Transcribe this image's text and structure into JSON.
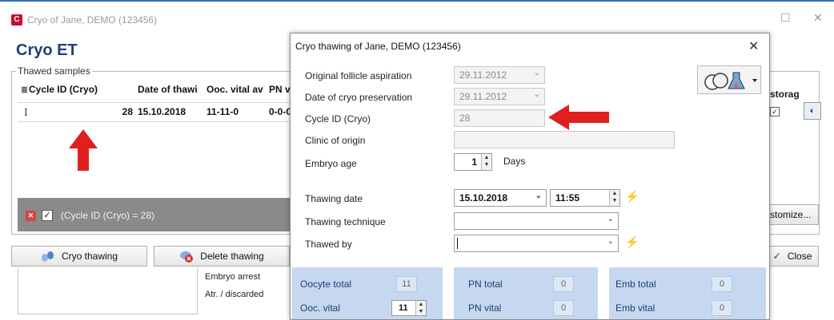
{
  "window": {
    "title": "Cryo of Jane, DEMO (123456)",
    "heading": "Cryo ET",
    "minimize_label": "—",
    "maximize_label": "☐",
    "close_label": "✕"
  },
  "thawed_samples": {
    "group_label": "Thawed samples",
    "columns": [
      "Cycle ID (Cryo)",
      "Date of thawi",
      "Ooc. vital av",
      "PN v"
    ],
    "row": {
      "cycle_id": "28",
      "date": "15.10.2018",
      "ooc_vital": "11-11-0",
      "pn": "0-0-0"
    },
    "filter_text": "(Cycle ID (Cryo) = 28)",
    "storage_header": "storag",
    "customize_label": "stomize...",
    "close_label": "Close"
  },
  "buttons": {
    "cryo_thawing": "Cryo thawing",
    "delete_thawing": "Delete thawing"
  },
  "lower_list": {
    "items": [
      "Embryo arrest",
      "Atr. / discarded"
    ]
  },
  "dialog": {
    "title": "Cryo thawing of Jane, DEMO (123456)",
    "close_label": "✕",
    "fields": {
      "original_follicle_aspiration": {
        "label": "Original follicle aspiration",
        "value": "29.11.2012"
      },
      "date_of_cryo_preservation": {
        "label": "Date of cryo preservation",
        "value": "29.11.2012"
      },
      "cycle_id_cryo": {
        "label": "Cycle ID (Cryo)",
        "value": "28"
      },
      "clinic_of_origin": {
        "label": "Clinic of origin",
        "value": ""
      },
      "embryo_age": {
        "label": "Embryo age",
        "value": "1",
        "unit": "Days"
      },
      "thawing_date": {
        "label": "Thawing date",
        "date": "15.10.2018",
        "time": "11:55"
      },
      "thawing_technique": {
        "label": "Thawing technique",
        "value": ""
      },
      "thawed_by": {
        "label": "Thawed by",
        "value": ""
      }
    },
    "stats": {
      "oocyte_total": {
        "label": "Oocyte total",
        "value": "11"
      },
      "ooc_vital": {
        "label": "Ooc. vital",
        "value": "11"
      },
      "pn_total": {
        "label": "PN total",
        "value": "0"
      },
      "pn_vital": {
        "label": "PN vital",
        "value": "0"
      },
      "emb_total": {
        "label": "Emb total",
        "value": "0"
      },
      "emb_vital": {
        "label": "Emb vital",
        "value": "0"
      }
    }
  },
  "colors": {
    "title_blue": "#1f3f7a",
    "annotation_red": "#e02020",
    "stats_blue": "#c6d8ef",
    "filter_grey": "#8a8a8a"
  }
}
